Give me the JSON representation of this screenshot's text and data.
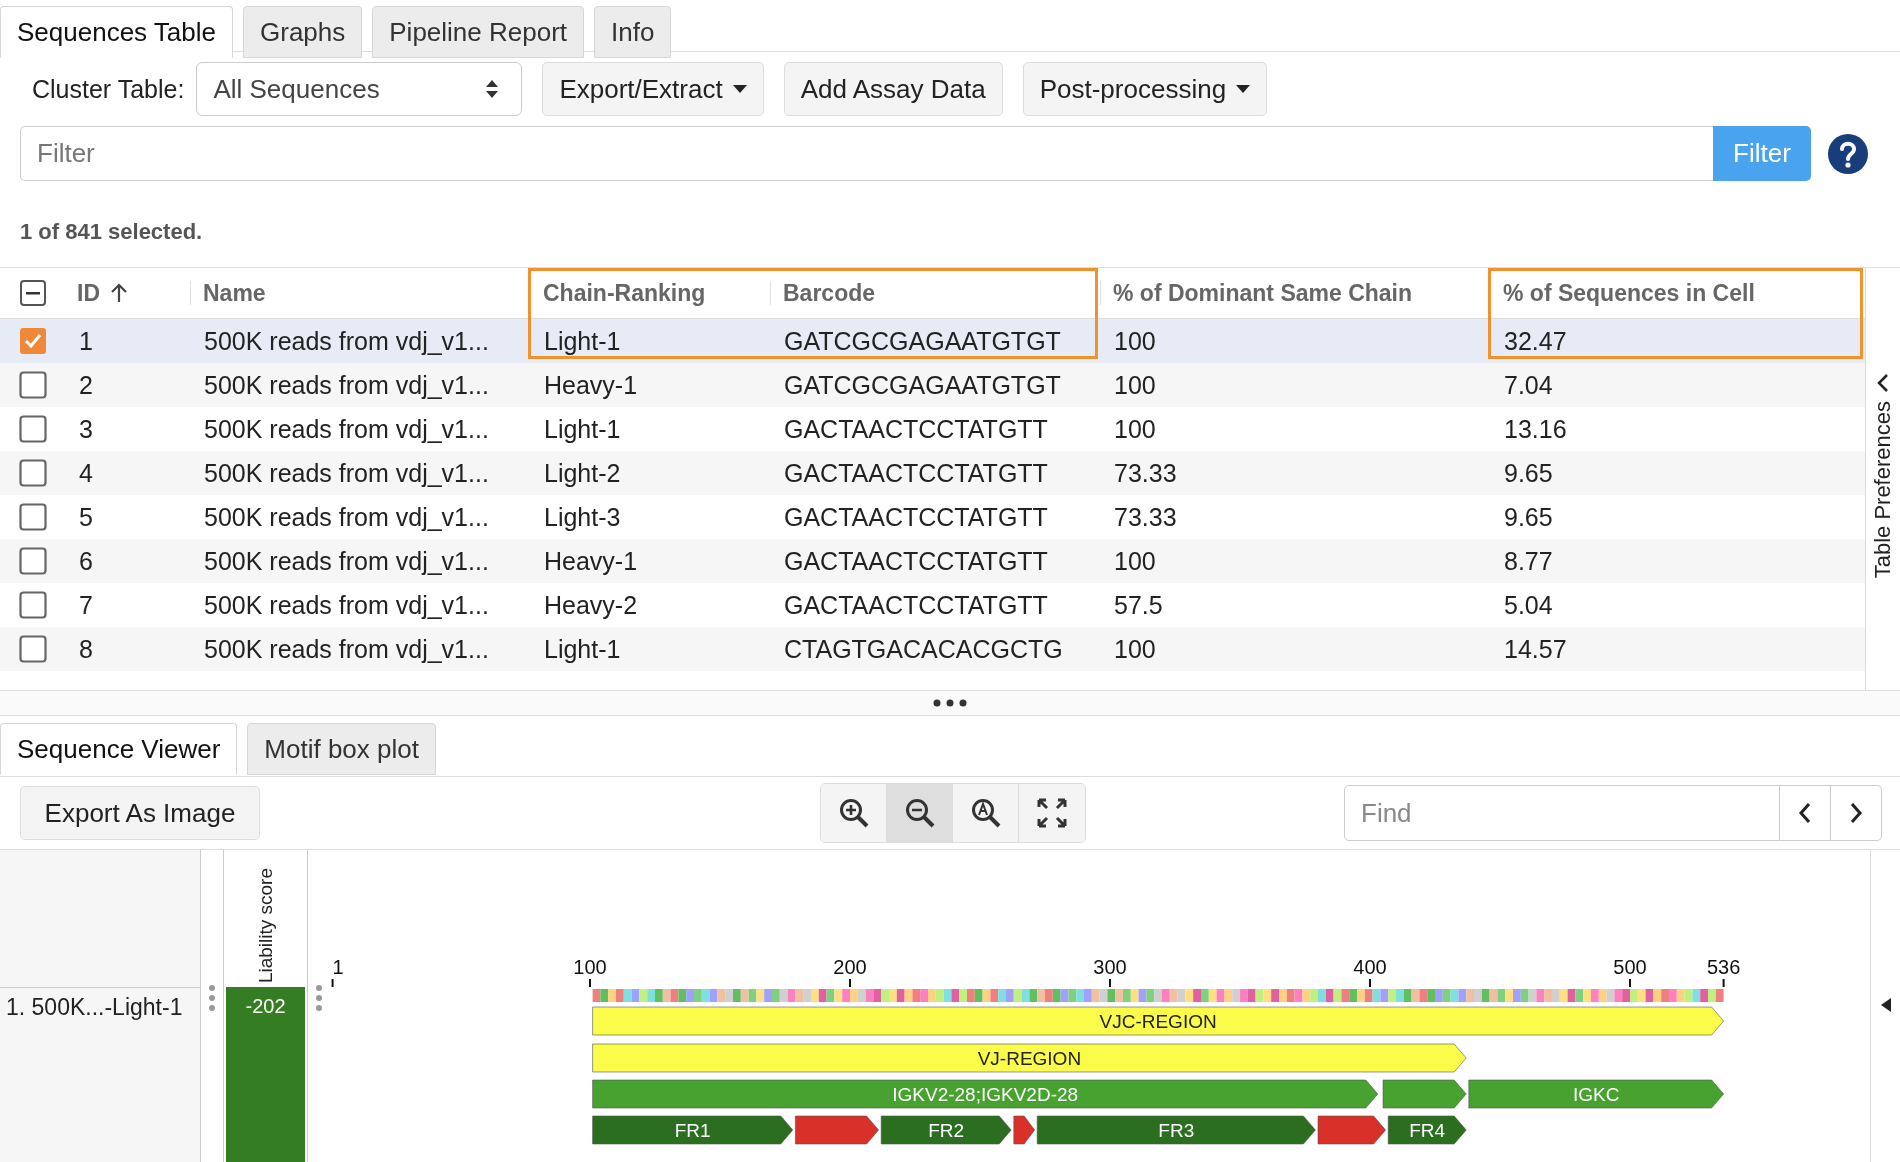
{
  "tabs": [
    {
      "label": "Sequences Table",
      "selected": true
    },
    {
      "label": "Graphs",
      "selected": false
    },
    {
      "label": "Pipeline Report",
      "selected": false
    },
    {
      "label": "Info",
      "selected": false
    }
  ],
  "toolbar": {
    "cluster_label": "Cluster Table:",
    "cluster_value": "All Sequences",
    "buttons": [
      {
        "label": "Export/Extract",
        "dropdown": true
      },
      {
        "label": "Add Assay Data",
        "dropdown": false
      },
      {
        "label": "Post-processing",
        "dropdown": true
      }
    ]
  },
  "filter": {
    "placeholder": "Filter",
    "button": "Filter"
  },
  "selection_summary": "1 of 841 selected.",
  "table": {
    "select_all_indeterminate": true,
    "columns": [
      {
        "label": "ID",
        "sort_ascending": true,
        "highlighted": false
      },
      {
        "label": "Name",
        "highlighted": false
      },
      {
        "label": "Chain-Ranking",
        "highlighted": true
      },
      {
        "label": "Barcode",
        "highlighted": true
      },
      {
        "label": "% of Dominant Same Chain",
        "highlighted": false
      },
      {
        "label": "% of Sequences in Cell",
        "highlighted": true
      }
    ],
    "rows": [
      {
        "selected": true,
        "cells": [
          "1",
          "500K reads from vdj_v1...",
          "Light-1",
          "GATCGCGAGAATGTGT",
          "100",
          "32.47"
        ]
      },
      {
        "selected": false,
        "cells": [
          "2",
          "500K reads from vdj_v1...",
          "Heavy-1",
          "GATCGCGAGAATGTGT",
          "100",
          "7.04"
        ]
      },
      {
        "selected": false,
        "cells": [
          "3",
          "500K reads from vdj_v1...",
          "Light-1",
          "GACTAACTCCTATGTT",
          "100",
          "13.16"
        ]
      },
      {
        "selected": false,
        "cells": [
          "4",
          "500K reads from vdj_v1...",
          "Light-2",
          "GACTAACTCCTATGTT",
          "73.33",
          "9.65"
        ]
      },
      {
        "selected": false,
        "cells": [
          "5",
          "500K reads from vdj_v1...",
          "Light-3",
          "GACTAACTCCTATGTT",
          "73.33",
          "9.65"
        ]
      },
      {
        "selected": false,
        "cells": [
          "6",
          "500K reads from vdj_v1...",
          "Heavy-1",
          "GACTAACTCCTATGTT",
          "100",
          "8.77"
        ]
      },
      {
        "selected": false,
        "cells": [
          "7",
          "500K reads from vdj_v1...",
          "Heavy-2",
          "GACTAACTCCTATGTT",
          "57.5",
          "5.04"
        ]
      },
      {
        "selected": false,
        "cells": [
          "8",
          "500K reads from vdj_v1...",
          "Light-1",
          "CTAGTGACACACGCTG",
          "100",
          "14.57"
        ]
      }
    ],
    "side_panel": "Table Preferences"
  },
  "viewer": {
    "tabs": [
      {
        "label": "Sequence Viewer",
        "selected": true
      },
      {
        "label": "Motif box plot",
        "selected": false
      }
    ],
    "export_button": "Export As Image",
    "zoom_buttons": [
      {
        "kind": "zoom-in",
        "selected": false
      },
      {
        "kind": "zoom-out",
        "selected": true
      },
      {
        "kind": "zoom-reset",
        "selected": false
      },
      {
        "kind": "fit",
        "selected": false
      }
    ],
    "find": {
      "placeholder": "Find"
    },
    "liability_header": "Liability score",
    "sequences": [
      {
        "label": "1. 500K...-Light-1",
        "liability": "-202"
      }
    ],
    "ruler": [
      "1",
      "100",
      "200",
      "300",
      "400",
      "500",
      "536"
    ],
    "tracks": [
      [
        {
          "label": "VJC-REGION",
          "color": "#fbfb4a"
        }
      ],
      [
        {
          "label": "VJ-REGION",
          "color": "#fbfb4a"
        }
      ],
      [
        {
          "label": "IGKV2-28;IGKV2D-28",
          "color": "#47a230"
        },
        {
          "color": "#47a230"
        },
        {
          "label": "IGKC",
          "color": "#47a230"
        }
      ],
      [
        {
          "label": "FR1",
          "color": "#2c6e1f"
        },
        {
          "color": "#d9302a"
        },
        {
          "label": "FR2",
          "color": "#2c6e1f"
        },
        {
          "color": "#d9302a"
        },
        {
          "label": "FR3",
          "color": "#2c6e1f"
        },
        {
          "color": "#d9302a"
        },
        {
          "label": "FR4",
          "color": "#2c6e1f"
        }
      ]
    ]
  }
}
